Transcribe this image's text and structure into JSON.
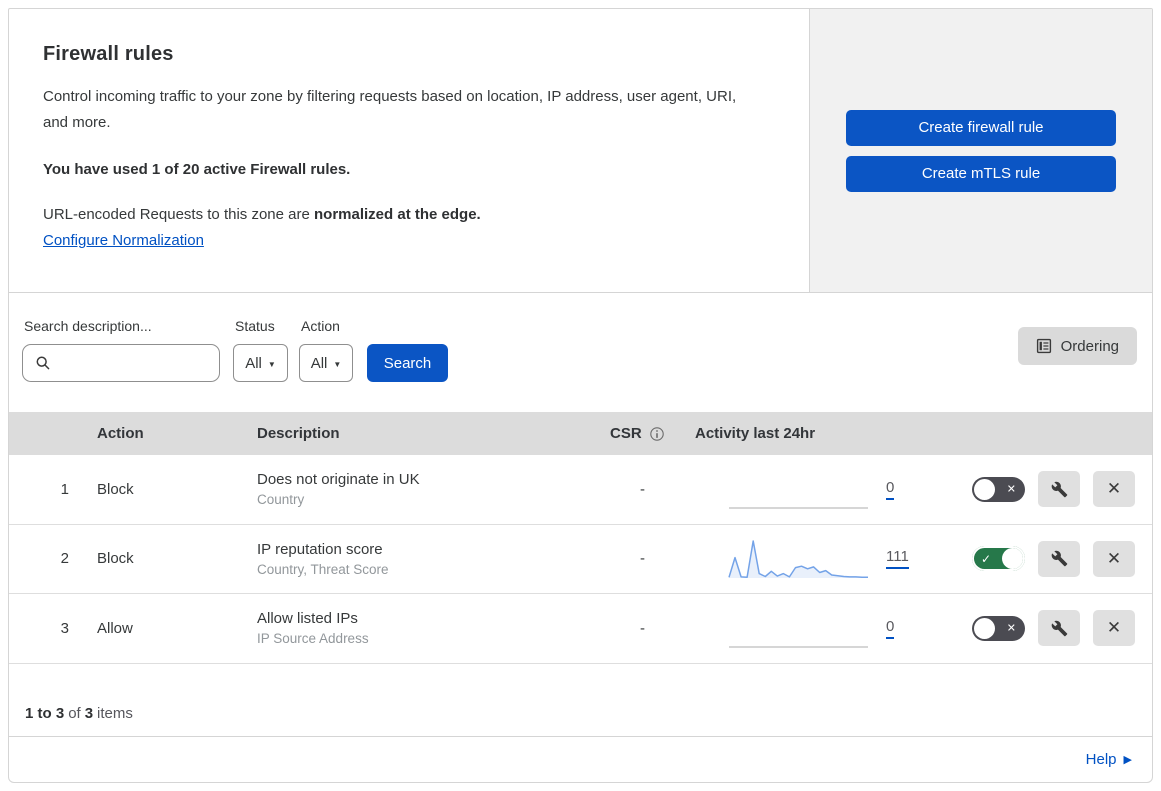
{
  "header": {
    "title": "Firewall rules",
    "description": "Control incoming traffic to your zone by filtering requests based on location, IP address, user agent, URI, and more.",
    "usage_note": "You have used 1 of 20 active Firewall rules.",
    "normalization_text": "URL-encoded Requests to this zone are ",
    "normalization_bold": "normalized at the edge.",
    "normalization_link": "Configure Normalization",
    "create_firewall_button": "Create firewall rule",
    "create_mtls_button": "Create mTLS rule"
  },
  "filters": {
    "search_label": "Search description...",
    "status_label": "Status",
    "status_value": "All",
    "action_label": "Action",
    "action_value": "All",
    "search_button": "Search",
    "ordering_button": "Ordering"
  },
  "table": {
    "columns": {
      "action": "Action",
      "description": "Description",
      "csr": "CSR",
      "activity": "Activity last 24hr"
    },
    "rows": [
      {
        "index": "1",
        "action": "Block",
        "description": "Does not originate in UK",
        "fields": "Country",
        "csr": "-",
        "activity_count": "0",
        "enabled": false
      },
      {
        "index": "2",
        "action": "Block",
        "description": "IP reputation score",
        "fields": "Country, Threat Score",
        "csr": "-",
        "activity_count": "111",
        "enabled": true
      },
      {
        "index": "3",
        "action": "Allow",
        "description": "Allow listed IPs",
        "fields": "IP Source Address",
        "csr": "-",
        "activity_count": "0",
        "enabled": false
      }
    ]
  },
  "footer": {
    "range_bold": "1 to 3",
    "of_text": "of",
    "total_bold": "3",
    "items_text": "items",
    "help_label": "Help"
  },
  "icons": {
    "search": "magnifier",
    "info": "circled-i",
    "ordering": "list-document",
    "wrench": "wrench",
    "delete_glyph": "✕",
    "toggle_check": "✓",
    "toggle_x": "✕",
    "dropdown_arrow": "▼",
    "help_arrow": "▶"
  },
  "colors": {
    "accent_blue": "#0b55c4",
    "link_blue": "#0051c3",
    "toggle_on_green": "#26784a",
    "toggle_off_grey": "#4b4b52",
    "sparkline_blue": "#74a3e8",
    "panel_grey": "#f1f1f1",
    "table_header_grey": "#dcdcdc"
  },
  "chart_data": {
    "type": "line",
    "title": "Activity last 24hr sparkline (rule 2)",
    "xlabel": "last 24 hours (unlabeled)",
    "ylabel": "requests (relative, unlabeled)",
    "total_requests": 111,
    "ylim": [
      0,
      100
    ],
    "grid": false,
    "legend": "none",
    "series": [
      {
        "name": "rule-2-activity",
        "values": [
          2,
          55,
          3,
          2,
          100,
          12,
          4,
          18,
          5,
          12,
          3,
          28,
          32,
          25,
          30,
          15,
          20,
          8,
          6,
          4,
          3,
          3,
          2,
          2
        ]
      }
    ],
    "flat_series_note": "rules 1 and 3 show a flat zero line"
  }
}
